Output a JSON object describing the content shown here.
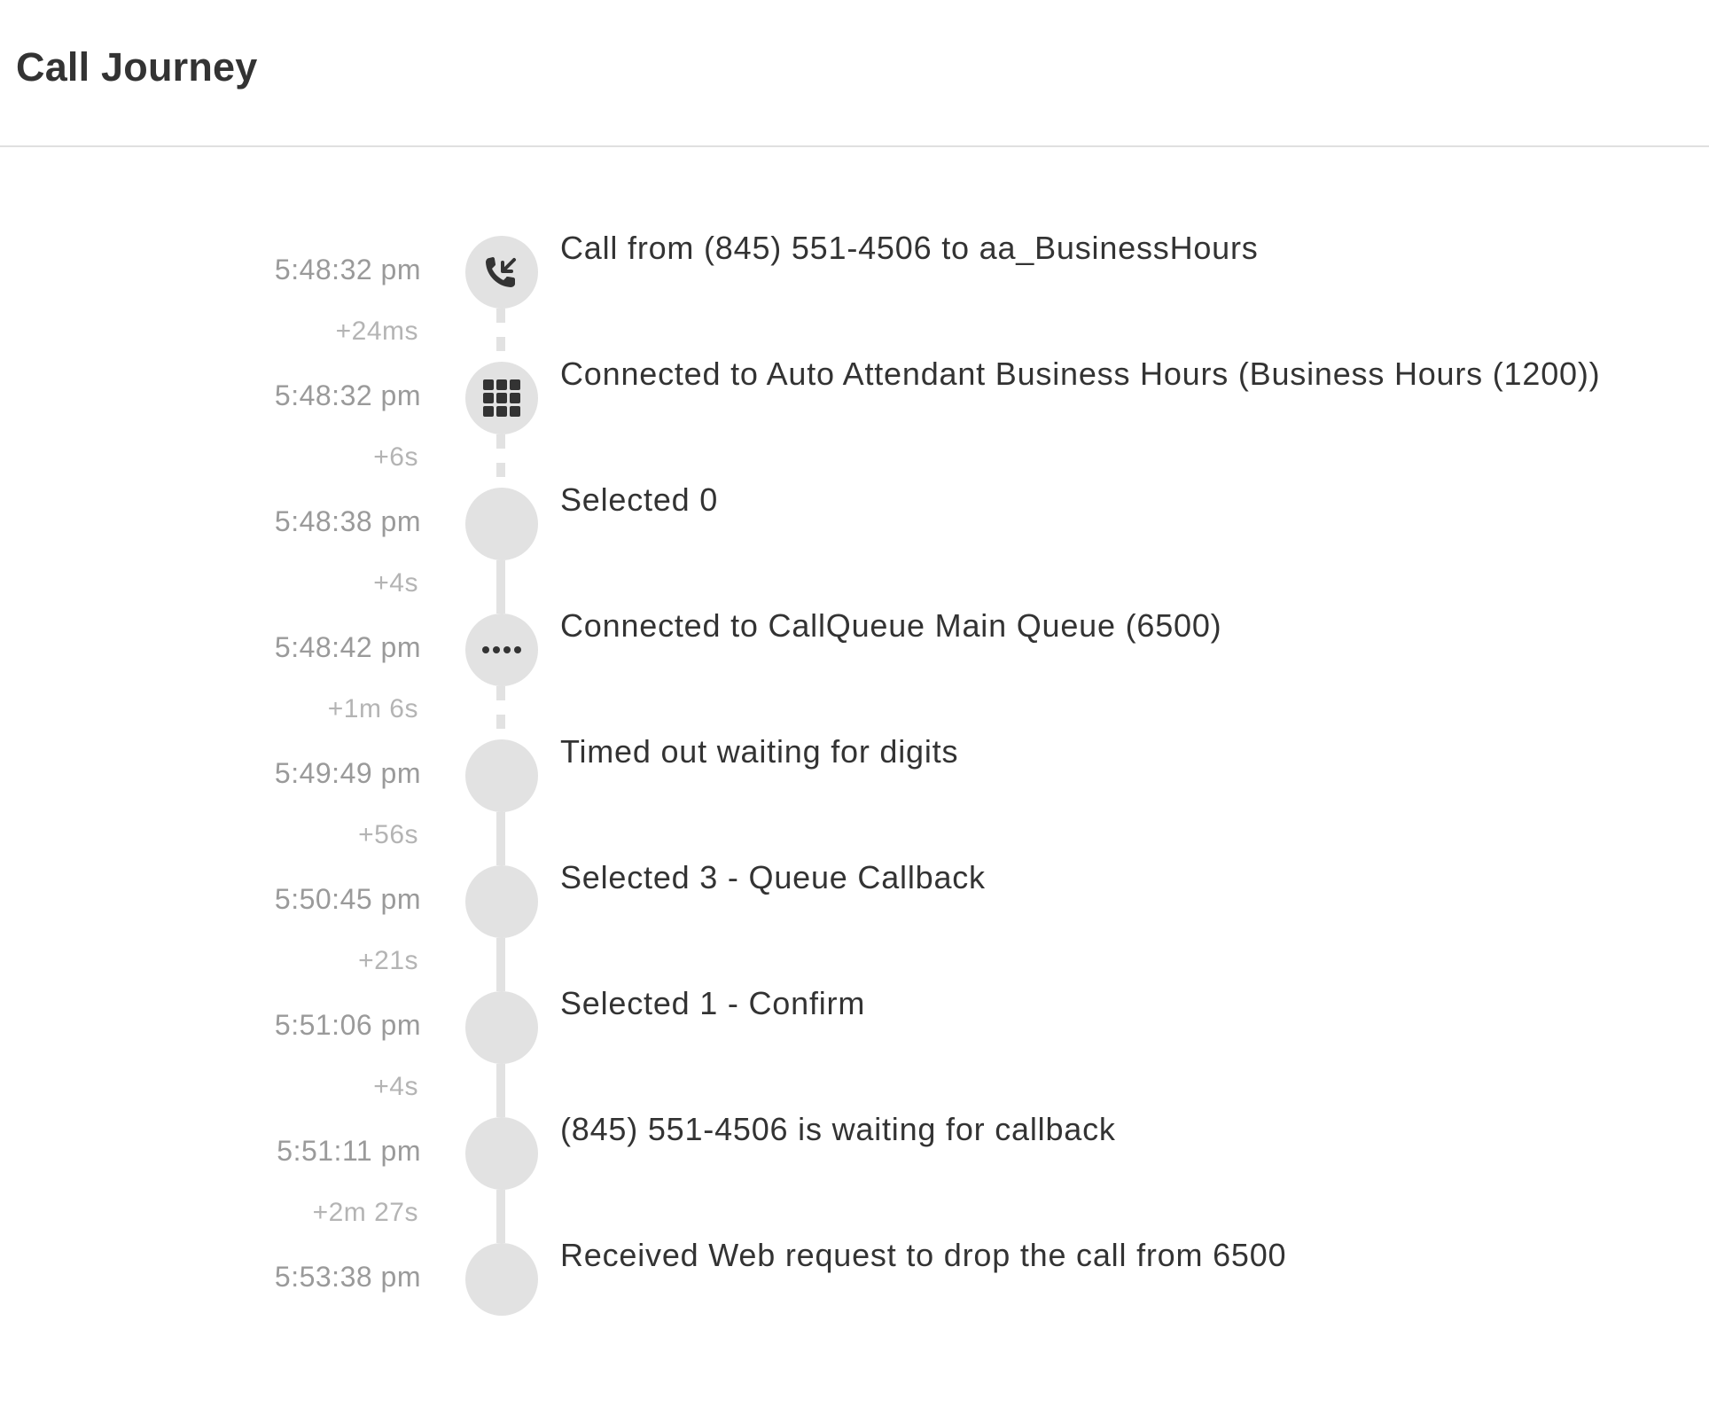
{
  "page": {
    "title": "Call Journey"
  },
  "events": [
    {
      "time": "5:48:32 pm",
      "description": "Call from (845) 551-4506 to aa_BusinessHours",
      "icon": "incoming-call-icon",
      "delta_after": "+24ms",
      "connector_after": "dashed"
    },
    {
      "time": "5:48:32 pm",
      "description": "Connected to Auto Attendant Business Hours (Business Hours (1200))",
      "icon": "keypad-grid-icon",
      "delta_after": "+6s",
      "connector_after": "dashed"
    },
    {
      "time": "5:48:38 pm",
      "description": "Selected 0",
      "icon": "",
      "delta_after": "+4s",
      "connector_after": "solid"
    },
    {
      "time": "5:48:42 pm",
      "description": "Connected to CallQueue Main Queue (6500)",
      "icon": "queue-dots-icon",
      "delta_after": "+1m 6s",
      "connector_after": "dashed"
    },
    {
      "time": "5:49:49 pm",
      "description": "Timed out waiting for digits",
      "icon": "",
      "delta_after": "+56s",
      "connector_after": "solid"
    },
    {
      "time": "5:50:45 pm",
      "description": "Selected 3 - Queue Callback",
      "icon": "",
      "delta_after": "+21s",
      "connector_after": "solid"
    },
    {
      "time": "5:51:06 pm",
      "description": "Selected 1 - Confirm",
      "icon": "",
      "delta_after": "+4s",
      "connector_after": "solid"
    },
    {
      "time": "5:51:11 pm",
      "description": "(845) 551-4506 is waiting for callback",
      "icon": "",
      "delta_after": "+2m 27s",
      "connector_after": "solid"
    },
    {
      "time": "5:53:38 pm",
      "description": "Received Web request to drop the call from 6500",
      "icon": "",
      "delta_after": "",
      "connector_after": ""
    }
  ],
  "colors": {
    "circle": "#e2e2e2",
    "icon": "#333333",
    "time_text": "#9a9a9a",
    "delta_text": "#b4b4b4",
    "description_text": "#333333",
    "divider": "#e0e0e0"
  }
}
